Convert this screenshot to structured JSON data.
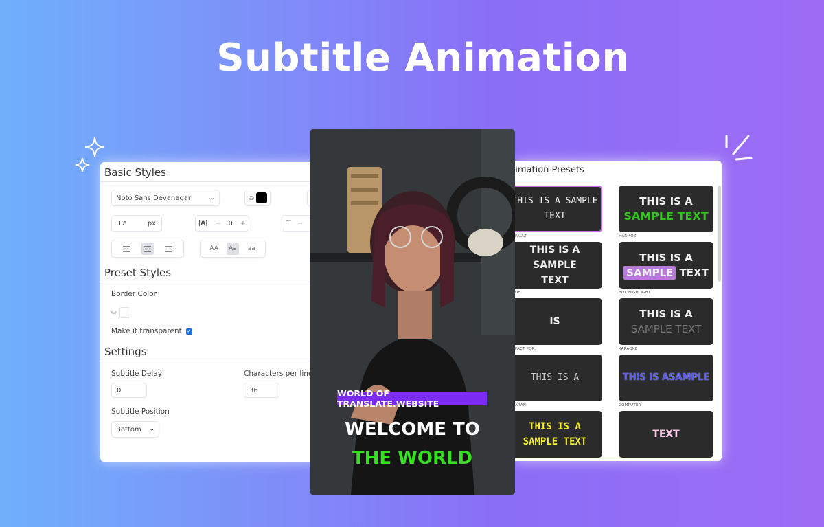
{
  "hero": {
    "title": "Subtitle Animation"
  },
  "colors": {
    "accent": "#7b2cf0",
    "green": "#34e020",
    "yellow": "#f2ee2e"
  },
  "basic_styles": {
    "heading": "Basic Styles",
    "font_select": "Noto Sans Devanagari",
    "font_size": "12",
    "font_unit": "px",
    "letter_spacing_value": "0",
    "letter_spacing_minus": "−",
    "letter_spacing_plus": "+",
    "line_height_minus": "−",
    "case_options": [
      "AA",
      "Aa",
      "aa"
    ],
    "selected_case": "Aa",
    "alignment_selected": "center"
  },
  "preset_styles": {
    "heading": "Preset Styles",
    "border_color_label": "Border Color",
    "transparent_label": "Make it transparent",
    "transparent_checked": true
  },
  "settings": {
    "heading": "Settings",
    "delay_label": "Subtitle Delay",
    "delay_value": "0",
    "chars_label": "Characters per line",
    "chars_value": "36",
    "position_label": "Subtitle Position",
    "position_value": "Bottom"
  },
  "video": {
    "badge": "WORLD OF TRANSLATE.WEBSITE",
    "line1": "WELCOME TO",
    "line2": "THE WORLD"
  },
  "animation_presets": {
    "heading": "nimation Presets",
    "cards": [
      {
        "lines": [
          "THIS IS A SAMPLE",
          "TEXT"
        ],
        "label": "FAULT"
      },
      {
        "lines": [
          "THIS IS A",
          "SAMPLE TEXT"
        ],
        "label": "HARMOZI"
      },
      {
        "lines": [
          "THIS IS A SAMPLE",
          "TEXT"
        ],
        "label": "DE"
      },
      {
        "lines": [
          "THIS IS A",
          "SAMPLE TEXT"
        ],
        "highlight": "SAMPLE",
        "label": "BOX HIGHLIGHT"
      },
      {
        "lines": [
          "IS"
        ],
        "label": "PACT POP"
      },
      {
        "lines": [
          "THIS IS A",
          "SAMPLE TEXT"
        ],
        "label": "KARAOKE"
      },
      {
        "lines": [
          "THIS IS A"
        ],
        "label": "ARAN"
      },
      {
        "lines": [
          "THIS IS ASAMPLE"
        ],
        "label": "COMPUTER"
      },
      {
        "lines": [
          "THIS IS A",
          "SAMPLE TEXT"
        ],
        "label": ""
      },
      {
        "lines": [
          "TEXT"
        ],
        "label": ""
      }
    ]
  }
}
